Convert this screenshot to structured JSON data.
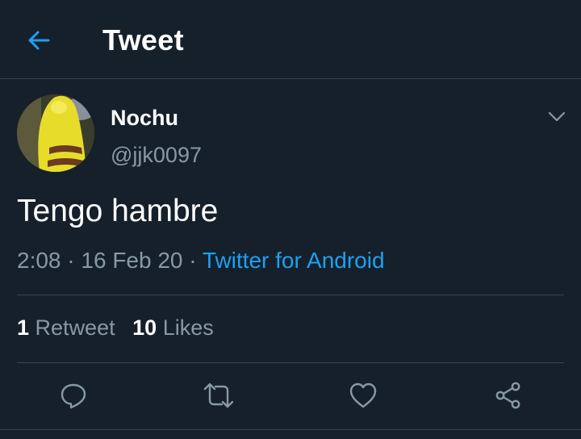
{
  "header": {
    "back_icon": "arrow-left-icon",
    "title": "Tweet"
  },
  "tweet": {
    "author_name": "Nochu",
    "author_handle": "@jjk0097",
    "text": "Tengo hambre",
    "time": "2:08",
    "date": "16 Feb 20",
    "separator": "·",
    "source": "Twitter for Android"
  },
  "stats": {
    "retweets_count": "1",
    "retweets_label": "Retweet",
    "likes_count": "10",
    "likes_label": "Likes"
  },
  "actions": [
    {
      "icon": "reply-icon"
    },
    {
      "icon": "retweet-icon"
    },
    {
      "icon": "like-icon"
    },
    {
      "icon": "share-icon"
    }
  ],
  "colors": {
    "background": "#15202b",
    "accent": "#1da1f2",
    "secondary_text": "#8899a6",
    "divider": "#38444d"
  }
}
